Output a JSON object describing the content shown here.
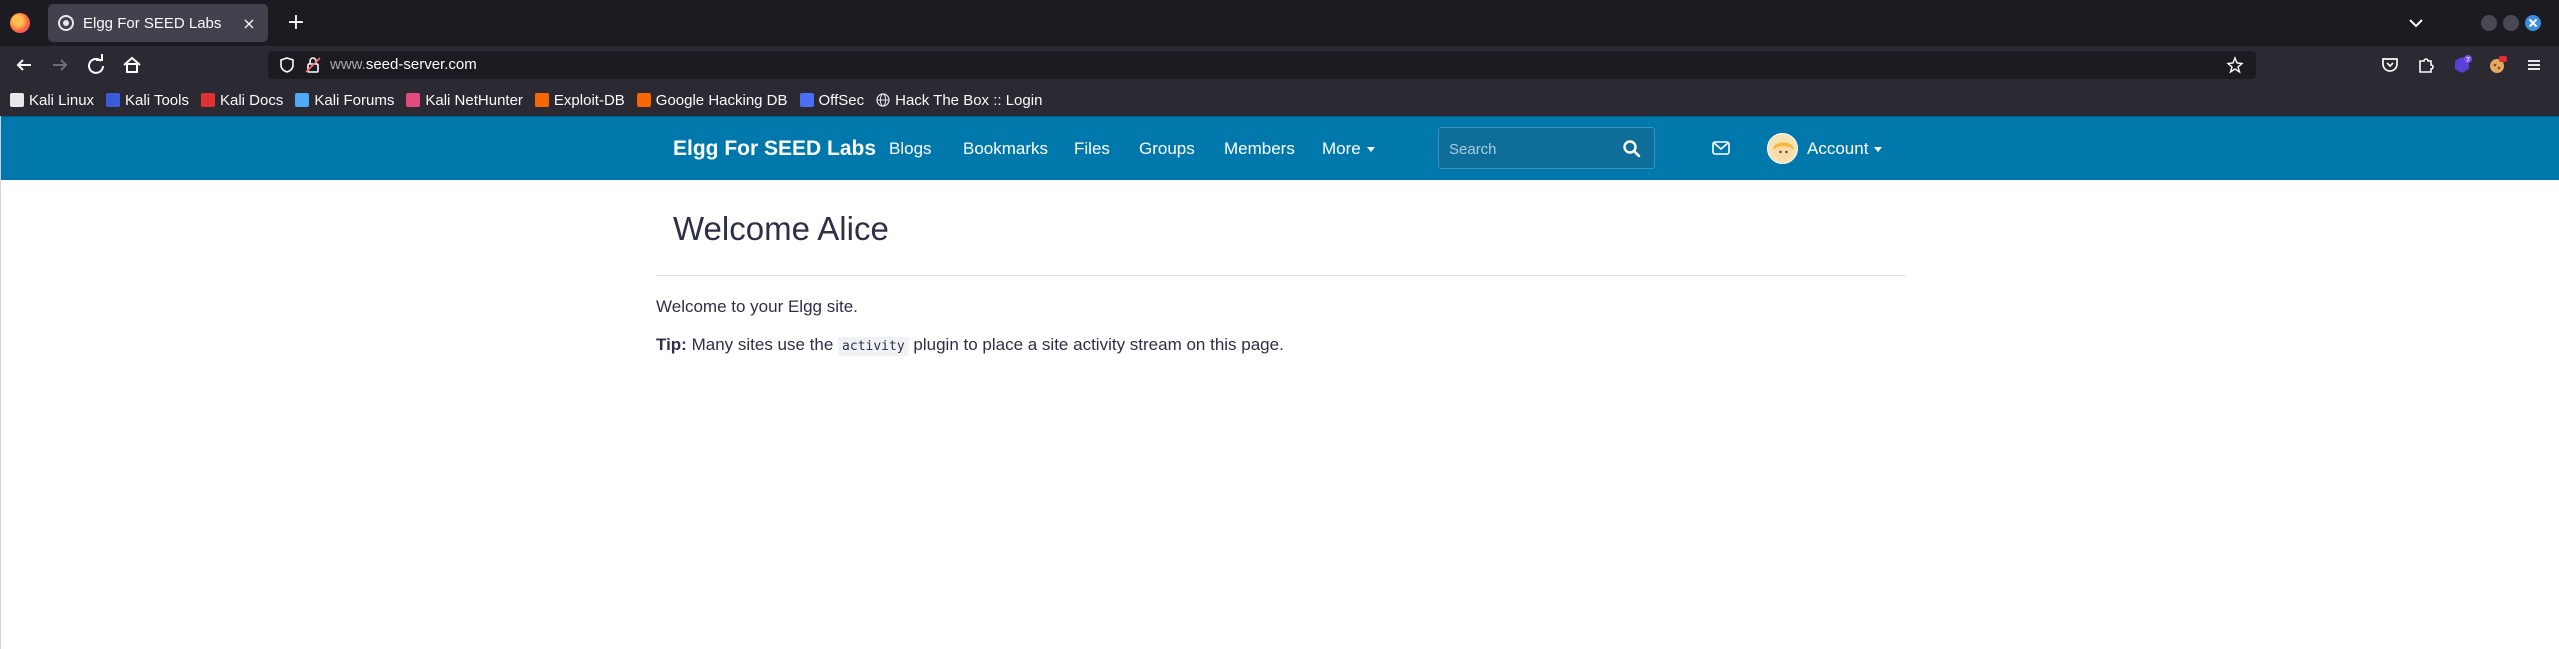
{
  "browser": {
    "tab": {
      "title": "Elgg For SEED Labs",
      "close": "×"
    },
    "new_tab": "+",
    "url": {
      "host_prefix": "www.",
      "host": "seed-server.com"
    },
    "extension_badge": "7",
    "bookmarks": [
      {
        "label": "Kali Linux",
        "icon": "kali-dragon-icon",
        "color": "#e8e8ec"
      },
      {
        "label": "Kali Tools",
        "icon": "kali-tools-icon",
        "color": "#3b5bdb"
      },
      {
        "label": "Kali Docs",
        "icon": "kali-docs-icon",
        "color": "#e03131"
      },
      {
        "label": "Kali Forums",
        "icon": "kali-forums-icon",
        "color": "#4dabf7"
      },
      {
        "label": "Kali NetHunter",
        "icon": "nethunter-icon",
        "color": "#e64980"
      },
      {
        "label": "Exploit-DB",
        "icon": "exploit-db-icon",
        "color": "#f76707"
      },
      {
        "label": "Google Hacking DB",
        "icon": "ghdb-icon",
        "color": "#f76707"
      },
      {
        "label": "OffSec",
        "icon": "offsec-icon",
        "color": "#4c6ef5"
      },
      {
        "label": "Hack The Box :: Login",
        "icon": "globe-icon",
        "color": "#e8e8ec"
      }
    ]
  },
  "site": {
    "name": "Elgg For SEED Labs",
    "brand_color": "#0078ac",
    "menu": [
      {
        "label": "Blogs"
      },
      {
        "label": "Bookmarks"
      },
      {
        "label": "Files"
      },
      {
        "label": "Groups"
      },
      {
        "label": "Members"
      },
      {
        "label": "More"
      }
    ],
    "search": {
      "placeholder": "Search"
    },
    "account_label": "Account"
  },
  "main": {
    "title": "Welcome Alice",
    "welcome_text": "Welcome to your Elgg site.",
    "tip_label": "Tip:",
    "tip_before": " Many sites use the ",
    "tip_code": "activity",
    "tip_after": " plugin to place a site activity stream on this page."
  }
}
